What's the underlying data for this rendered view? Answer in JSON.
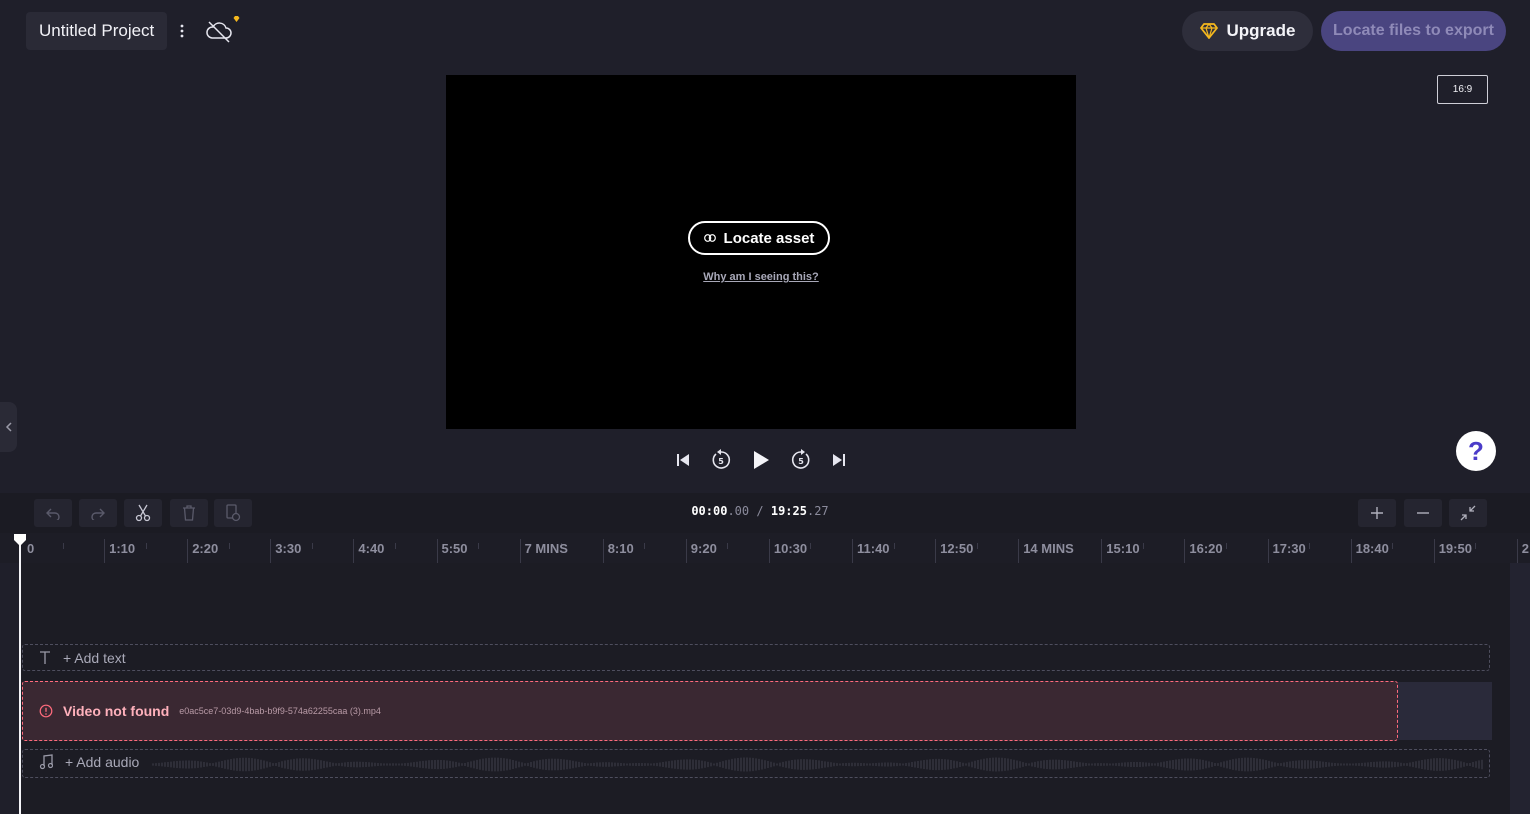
{
  "project": {
    "title": "Untitled Project"
  },
  "header": {
    "upgrade_label": "Upgrade",
    "export_label": "Locate files to export"
  },
  "preview": {
    "locate_label": "Locate asset",
    "why_label": "Why am I seeing this?",
    "aspect_ratio": "16:9"
  },
  "help": {
    "label": "?"
  },
  "timecode": {
    "current_main": "00:00",
    "current_frac": ".00",
    "sep": "/",
    "total_main": "19:25",
    "total_frac": ".27"
  },
  "ruler": {
    "labels": [
      "0",
      "1:10",
      "2:20",
      "3:30",
      "4:40",
      "5:50",
      "7 MINS",
      "8:10",
      "9:20",
      "10:30",
      "11:40",
      "12:50",
      "14 MINS",
      "15:10",
      "16:20",
      "17:30",
      "18:40",
      "19:50",
      "2"
    ]
  },
  "tracks": {
    "text_label": "+ Add text",
    "video_error": "Video not found",
    "video_filename": "e0ac5ce7-03d9-4bab-b9f9-574a62255caa (3).mp4",
    "audio_label": "+ Add audio"
  },
  "colors": {
    "accent": "#4a4580",
    "error": "#ff6b7d",
    "premium": "#f5b81e",
    "help": "#4b3cc9"
  }
}
